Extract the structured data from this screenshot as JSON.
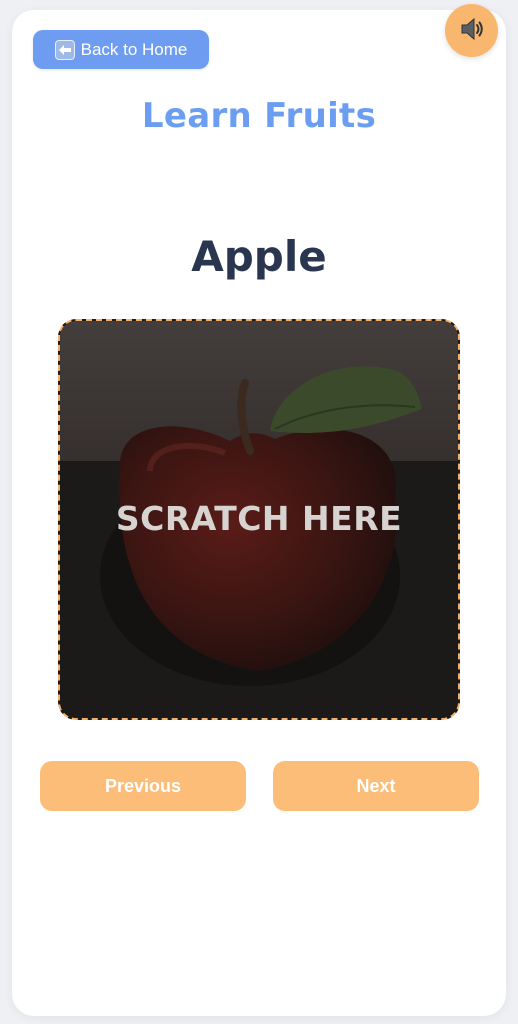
{
  "header": {
    "back_label": "Back to Home",
    "back_icon": "left-arrow-icon",
    "sound_icon": "speaker-icon"
  },
  "page": {
    "title": "Learn Fruits"
  },
  "card": {
    "fruit_name": "Apple",
    "scratch_label": "SCRATCH HERE",
    "image": "apple"
  },
  "nav": {
    "previous_label": "Previous",
    "next_label": "Next"
  },
  "colors": {
    "accent_blue": "#6b9ef0",
    "accent_orange": "#fbbd77",
    "dark_text": "#2a3550"
  }
}
